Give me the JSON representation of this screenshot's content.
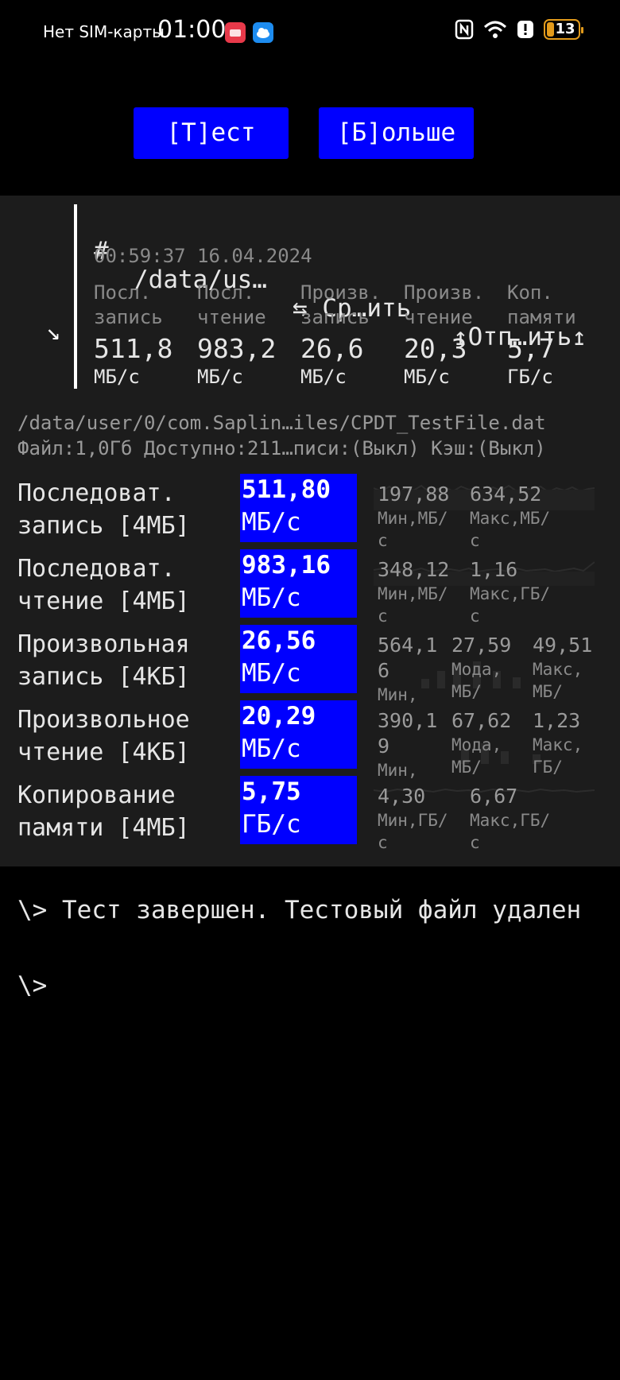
{
  "status_bar": {
    "carrier": "Нет SIM-карты",
    "time": "01:00",
    "battery": "13",
    "wifi_badge": "6"
  },
  "buttons": {
    "test": "[Т]ест",
    "more": "[Б]ольше"
  },
  "summary": {
    "arrow": "↘",
    "hash": "#",
    "path": "/data/us…",
    "compare": "⇆ Ср…ить",
    "send": "↥Отп…ить↥",
    "datetime": "00:59:37 16.04.2024",
    "columns": [
      {
        "label1": "Посл.",
        "label2": "запись",
        "value": "511,8",
        "unit": "МБ/с"
      },
      {
        "label1": "Посл.",
        "label2": "чтение",
        "value": "983,2",
        "unit": "МБ/с"
      },
      {
        "label1": "Произв.",
        "label2": "запись",
        "value": "26,6",
        "unit": "МБ/с"
      },
      {
        "label1": "Произв.",
        "label2": "чтение",
        "value": "20,3",
        "unit": "МБ/с"
      },
      {
        "label1": "Коп.",
        "label2": "памяти",
        "value": "5,7",
        "unit": "ГБ/с"
      }
    ]
  },
  "file": {
    "path": "/data/user/0/com.Saplin…iles/CPDT_TestFile.dat",
    "info": "Файл:1,0Гб Доступно:211…писи:(Выкл) Кэш:(Выкл)"
  },
  "tests": [
    {
      "name1": "Последоват.",
      "name2": "запись [4МБ]",
      "speed": "511,80",
      "unit": "МБ/с",
      "stats": [
        {
          "v": "197,88",
          "k": "Мин,МБ/с"
        },
        {
          "v": "634,52",
          "k": "Макс,МБ/с"
        }
      ]
    },
    {
      "name1": "Последоват.",
      "name2": "чтение [4МБ]",
      "speed": "983,16",
      "unit": "МБ/с",
      "stats": [
        {
          "v": "348,12",
          "k": "Мин,МБ/с"
        },
        {
          "v": "1,16",
          "k": "Макс,ГБ/с"
        }
      ]
    },
    {
      "name1": "Произвольная",
      "name2": "запись [4КБ]",
      "speed": "26,56",
      "unit": "МБ/с",
      "stats": [
        {
          "v": "564,1",
          "v2": "6",
          "k": "Мин,"
        },
        {
          "v": "27,59",
          "k": "Мода,",
          "k2": "МБ/"
        },
        {
          "v": "49,51",
          "k": "Макс,",
          "k2": "МБ/"
        }
      ]
    },
    {
      "name1": "Произвольное",
      "name2": "чтение [4КБ]",
      "speed": "20,29",
      "unit": "МБ/с",
      "stats": [
        {
          "v": "390,1",
          "v2": "9",
          "k": "Мин,"
        },
        {
          "v": "67,62",
          "k": "Мода,",
          "k2": "МБ/"
        },
        {
          "v": "1,23",
          "k": "Макс,",
          "k2": "ГБ/"
        }
      ]
    },
    {
      "name1": "Копирование",
      "name2": "памяти [4МБ]",
      "speed": "5,75",
      "unit": "ГБ/с",
      "stats": [
        {
          "v": "4,30",
          "k": "Мин,ГБ/с"
        },
        {
          "v": "6,67",
          "k": "Макс,ГБ/с"
        }
      ]
    }
  ],
  "console": {
    "line1": "\\> Тест завершен. Тестовый файл удален",
    "prompt": "\\>"
  },
  "colors": {
    "accent": "#0000ff",
    "panel": "#1c1c1c",
    "battery": "#e39b1b"
  }
}
